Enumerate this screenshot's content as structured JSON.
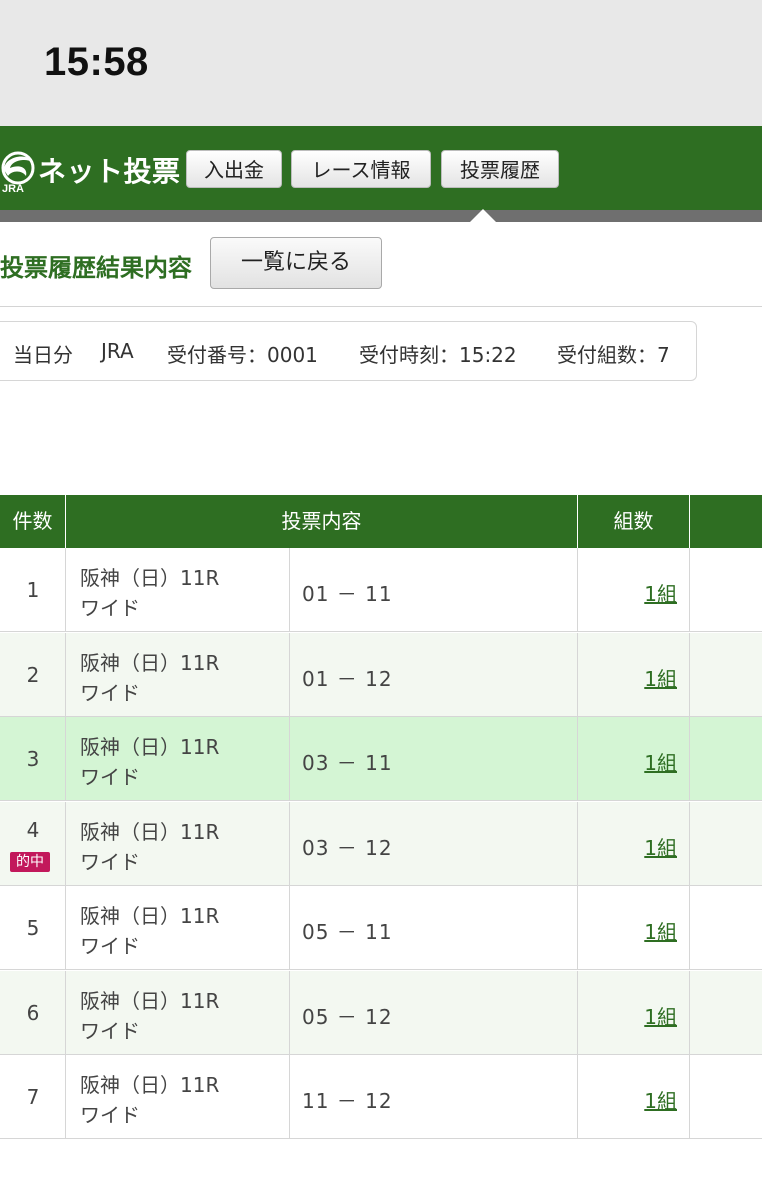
{
  "status_bar": {
    "time": "15:58"
  },
  "header": {
    "logo_text": "ネット投票",
    "logo_sub": "JRA",
    "nav": [
      "入出金",
      "レース情報",
      "投票履歴"
    ],
    "colors": {
      "primary": "#2e6e22",
      "hit_badge": "#c2185b",
      "highlight_row": "#d4f5d4"
    }
  },
  "page": {
    "title": "投票履歴結果内容",
    "back_label": "一覧に戻る"
  },
  "info": {
    "day": "当日分",
    "org": "JRA",
    "receipt_no": "受付番号：0001",
    "receipt_time": "受付時刻：15:22",
    "receipt_count": "受付組数：7"
  },
  "table": {
    "headers": [
      "件数",
      "投票内容",
      "組数"
    ],
    "rows": [
      {
        "num": "1",
        "race": "阪神（日）11R",
        "type": "ワイド",
        "combo": "01 － 11",
        "count": "1組",
        "hit": ""
      },
      {
        "num": "2",
        "race": "阪神（日）11R",
        "type": "ワイド",
        "combo": "01 － 12",
        "count": "1組",
        "hit": ""
      },
      {
        "num": "3",
        "race": "阪神（日）11R",
        "type": "ワイド",
        "combo": "03 － 11",
        "count": "1組",
        "hit": ""
      },
      {
        "num": "4",
        "race": "阪神（日）11R",
        "type": "ワイド",
        "combo": "03 － 12",
        "count": "1組",
        "hit": "的中"
      },
      {
        "num": "5",
        "race": "阪神（日）11R",
        "type": "ワイド",
        "combo": "05 － 11",
        "count": "1組",
        "hit": ""
      },
      {
        "num": "6",
        "race": "阪神（日）11R",
        "type": "ワイド",
        "combo": "05 － 12",
        "count": "1組",
        "hit": ""
      },
      {
        "num": "7",
        "race": "阪神（日）11R",
        "type": "ワイド",
        "combo": "11 － 12",
        "count": "1組",
        "hit": ""
      }
    ]
  }
}
